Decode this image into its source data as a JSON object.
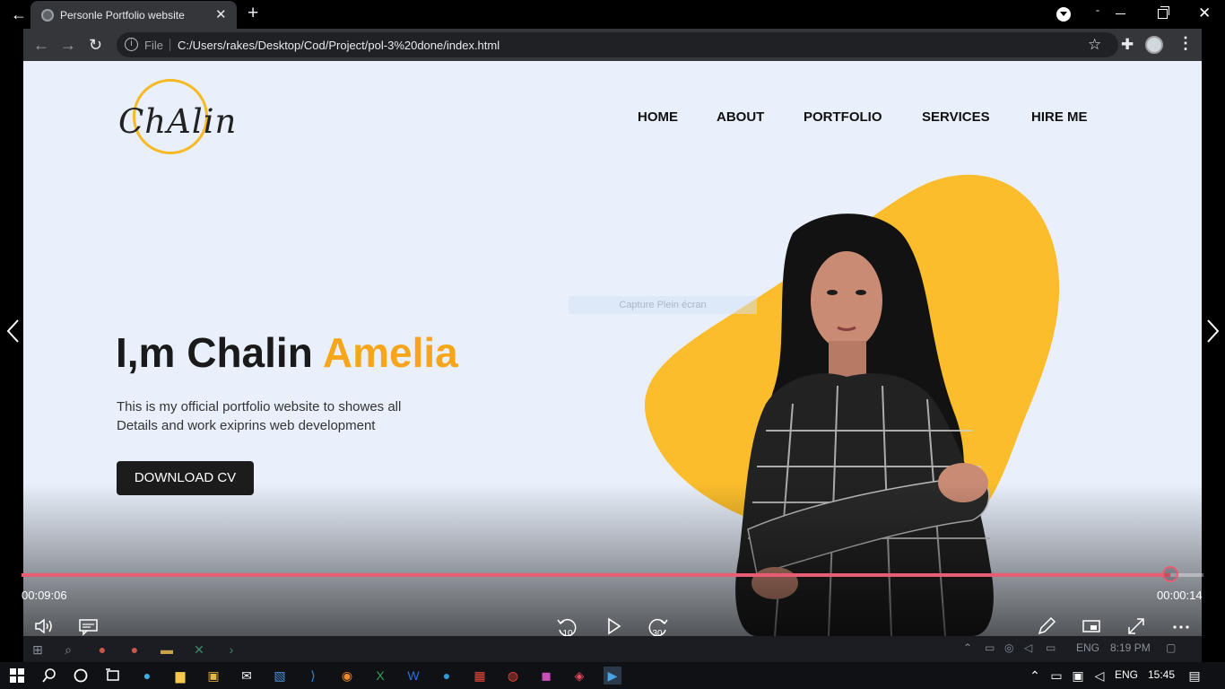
{
  "browser": {
    "tab_title": "Personle Portfolio website",
    "tab_close": "✕",
    "new_tab": "+",
    "file_label": "File",
    "url": "C:/Users/rakes/Desktop/Cod/Project/pol-3%20done/index.html",
    "window_dash": "-"
  },
  "site": {
    "logo_text": "ChAlin",
    "nav": [
      "HOME",
      "ABOUT",
      "PORTFOLIO",
      "SERVICES",
      "HIRE ME"
    ],
    "headline_main": "I,m Chalin ",
    "headline_accent": "Amelia",
    "intro_line1": "This is my official portfolio website to showes all",
    "intro_line2": "Details and work exiprins web development",
    "cv_button": "DOWNLOAD CV",
    "capture_tip": "Capture Plein écran",
    "colors": {
      "accent": "#f7a61b",
      "blob": "#fbbd2c",
      "background": "#e9f0fb"
    }
  },
  "player": {
    "elapsed": "00:09:06",
    "remaining": "00:00:14",
    "progress": 0.972,
    "rewind_label": "10",
    "forward_label": "30",
    "progress_color": "#e85d73"
  },
  "inner_taskbar": {
    "lang": "ENG",
    "time": "8:19 PM"
  },
  "taskbar": {
    "lang": "ENG",
    "time": "15:45"
  }
}
